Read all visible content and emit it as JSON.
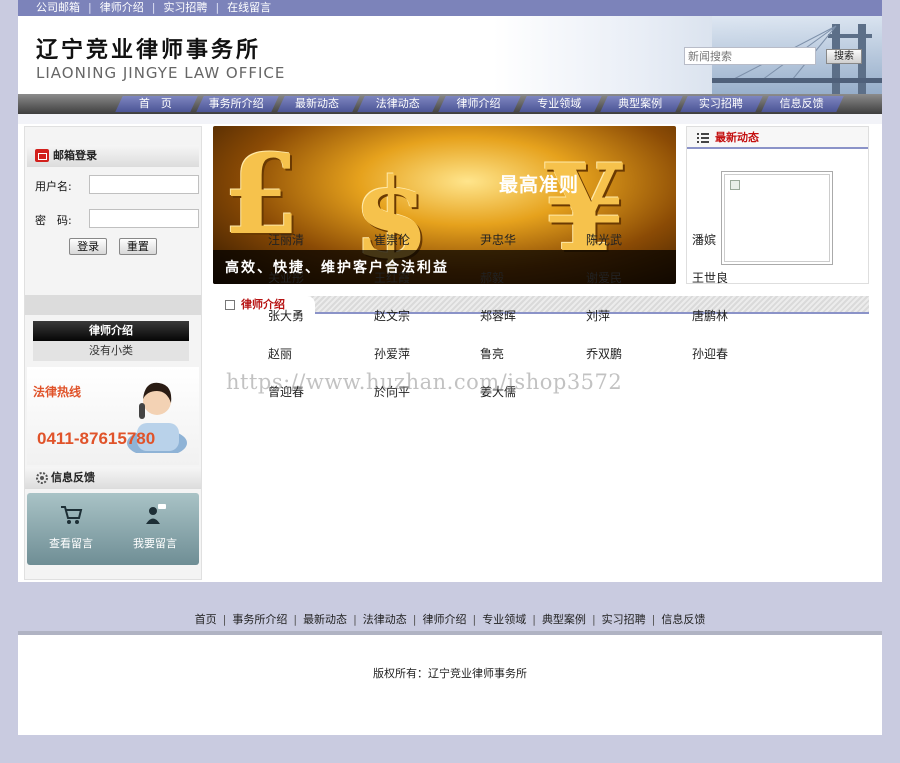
{
  "topbar": {
    "links": [
      "公司邮箱",
      "律师介绍",
      "实习招聘",
      "在线留言"
    ]
  },
  "header": {
    "logo_cn": "辽宁竞业律师事务所",
    "logo_en": "LIAONING JINGYE LAW OFFICE",
    "search_placeholder": "新闻搜索",
    "search_button": "搜索"
  },
  "nav": {
    "items": [
      "首　页",
      "事务所介绍",
      "最新动态",
      "法律动态",
      "律师介绍",
      "专业领域",
      "典型案例",
      "实习招聘",
      "信息反馈"
    ]
  },
  "sidebar": {
    "mail_login": {
      "title": "邮箱登录",
      "username_label": "用户名:",
      "password_label": "密　码:",
      "login_button": "登录",
      "reset_button": "重置"
    },
    "lawyer_box": {
      "title": "律师介绍",
      "empty": "没有小类"
    },
    "hotline": {
      "label": "法律热线",
      "number": "0411-87615780"
    },
    "feedback": {
      "title": "信息反馈",
      "view_label": "查看留言",
      "post_label": "我要留言"
    }
  },
  "banner": {
    "headline": "最高准则",
    "slogan": "高效、快捷、维护客户合法利益"
  },
  "news": {
    "title": "最新动态"
  },
  "lawyers": {
    "title": "律师介绍",
    "names": [
      "汪丽清",
      "崔崇伦",
      "尹忠华",
      "陈光武",
      "潘嫔",
      "关业彤",
      "王红霞",
      "郝毅",
      "谢爱民",
      "王世良",
      "张大勇",
      "赵文宗",
      "郑蓉晖",
      "刘萍",
      "唐鹏林",
      "赵丽",
      "孙爱萍",
      "鲁亮",
      "乔双鹏",
      "孙迎春",
      "曾迎春",
      "於向平",
      "姜大儒"
    ]
  },
  "watermark": "https://www.huzhan.com/ishop3572",
  "footer": {
    "links": [
      "首页",
      "事务所介绍",
      "最新动态",
      "法律动态",
      "律师介绍",
      "专业领域",
      "典型案例",
      "实习招聘",
      "信息反馈"
    ],
    "copyright": "版权所有：辽宁竞业律师事务所"
  },
  "colors": {
    "topbar": "#7c83ba",
    "nav_tab": "#5a63a6",
    "accent_red": "#c41010",
    "hotline": "#e0532a",
    "page_bg": "#c9cbe0"
  }
}
